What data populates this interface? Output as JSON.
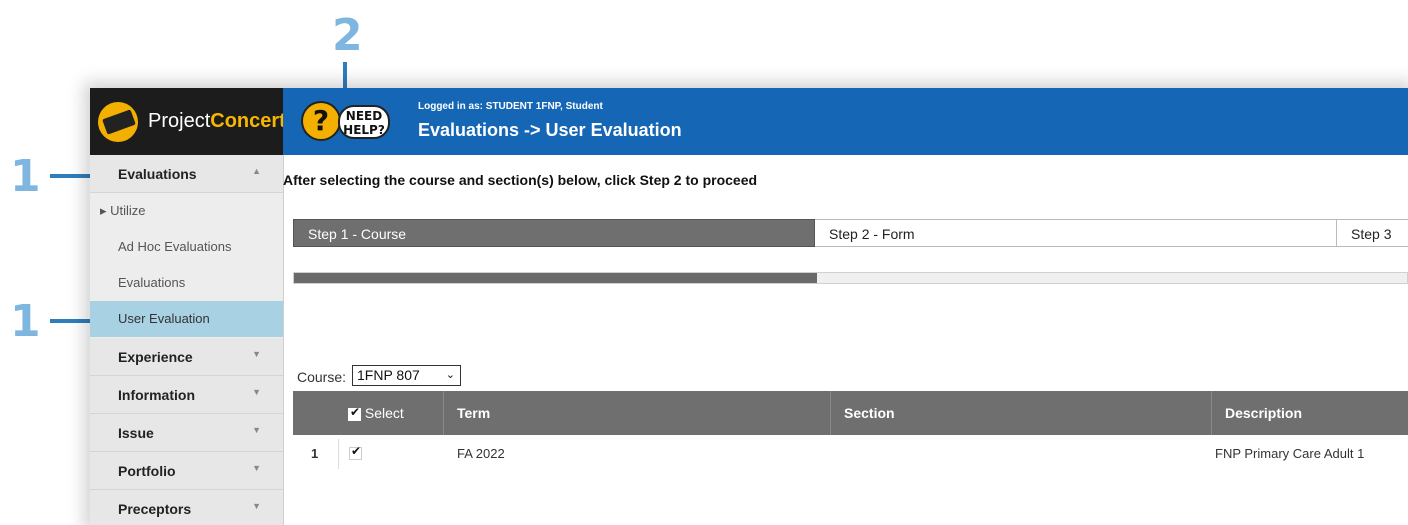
{
  "callouts": {
    "one_a": "1",
    "one_b": "1",
    "two": "2"
  },
  "branding": {
    "project": "Project",
    "concert": "Concert"
  },
  "help": {
    "mark": "?",
    "line1": "NEED",
    "line2": "HELP?"
  },
  "header": {
    "logged_in": "Logged in as: STUDENT 1FNP, Student",
    "title": "Evaluations -> User Evaluation"
  },
  "sidebar": {
    "sections": [
      {
        "label": "Evaluations",
        "caret": "▲"
      },
      {
        "label": "Experience",
        "caret": "▼"
      },
      {
        "label": "Information",
        "caret": "▼"
      },
      {
        "label": "Issue",
        "caret": "▼"
      },
      {
        "label": "Portfolio",
        "caret": "▼"
      },
      {
        "label": "Preceptors",
        "caret": "▼"
      }
    ],
    "utilize": "▸ Utilize",
    "items": [
      {
        "label": "Ad Hoc Evaluations"
      },
      {
        "label": "Evaluations"
      },
      {
        "label": "User Evaluation"
      }
    ]
  },
  "content": {
    "instruction": "After selecting the course and section(s) below, click Step 2 to proceed",
    "steps": [
      "Step 1 - Course",
      "Step 2 - Form",
      "Step 3"
    ],
    "progress_fraction": 0.47,
    "course_label": "Course:",
    "course_value": "1FNP 807",
    "table": {
      "headers": {
        "select": "Select",
        "term": "Term",
        "section": "Section",
        "description": "Description"
      },
      "rows": [
        {
          "num": "1",
          "checked": "✔",
          "term": "FA 2022",
          "section": "",
          "description": "FNP Primary Care Adult 1"
        }
      ]
    }
  },
  "colors": {
    "header_blue": "#1567b6",
    "active_item": "#a8d1e4",
    "step_active": "#6f6f6f",
    "callout_arrow": "#2e7dbd"
  }
}
